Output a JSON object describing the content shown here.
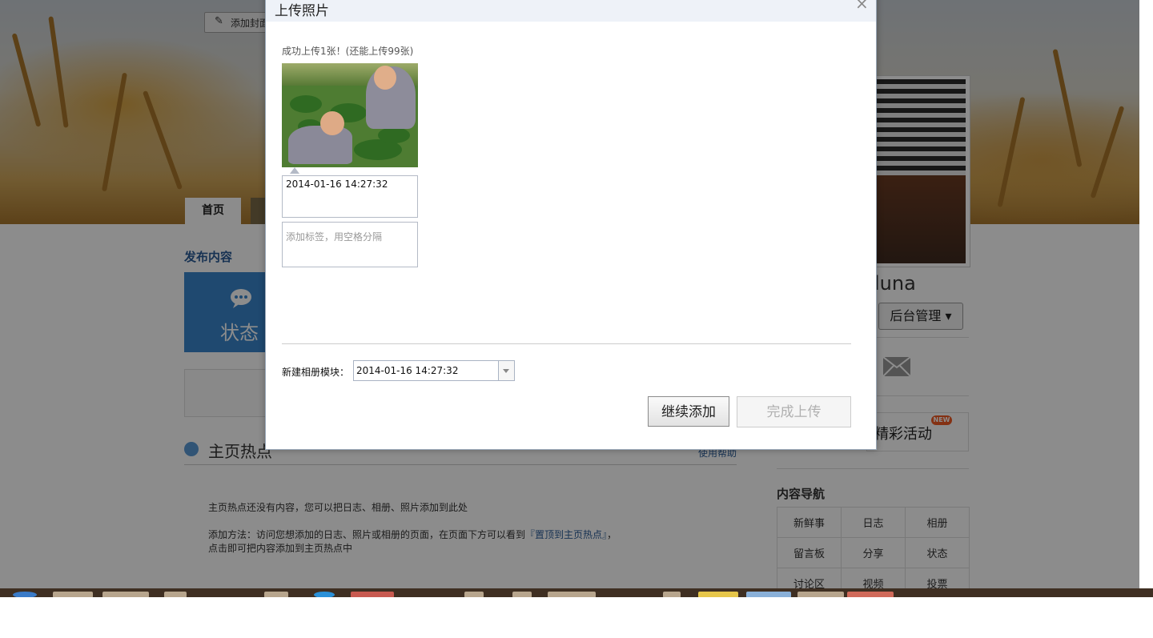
{
  "cover_button": {
    "label": "添加封面"
  },
  "tabs": {
    "home": "首页"
  },
  "sidebar": {
    "username": "luna",
    "admin_button": "后台管理",
    "events_label": "精彩活动",
    "new_badge": "NEW",
    "content_nav_title": "内容导航",
    "nav_items": [
      "新鲜事",
      "日志",
      "相册",
      "留言板",
      "分享",
      "状态",
      "讨论区",
      "视频",
      "投票"
    ]
  },
  "main": {
    "publish_title": "发布内容",
    "status_tile": "状态",
    "hot_title": "主页热点",
    "help_link": "使用帮助",
    "hot_empty": "主页热点还没有内容，您可以把日志、相册、照片添加到此处",
    "hot_method_prefix": "添加方法：访问您想添加的日志、照片或相册的页面，在页面下方可以看到",
    "hot_method_link": "『置顶到主页热点』",
    "hot_method_suffix": "，",
    "hot_method_line2": "点击即可把内容添加到主页热点中"
  },
  "dialog": {
    "title": "上传照片",
    "close": "×",
    "upload_status": "成功上传1张！(还能上传99张)",
    "photo_description": "2014-01-16 14:27:32",
    "tag_placeholder": "添加标签，用空格分隔",
    "album_label": "新建相册模块：",
    "album_value": "2014-01-16 14:27:32",
    "continue_button": "继续添加",
    "finish_button": "完成上传"
  }
}
